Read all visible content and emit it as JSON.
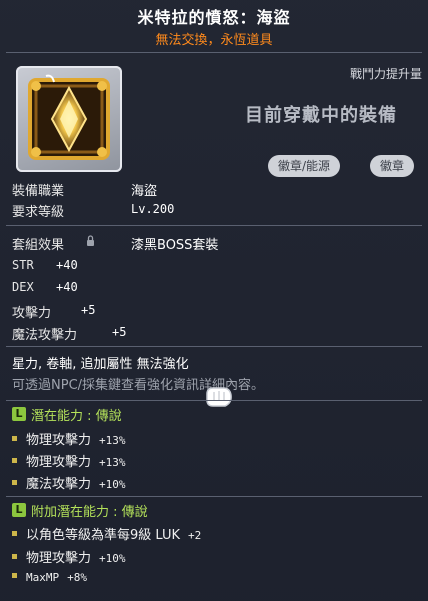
{
  "item": {
    "name": "米特拉的憤怒：海盜",
    "trade_note": "無法交換，永恆道具"
  },
  "header": {
    "power_up": "戰鬥力提升量",
    "current_equipped": "目前穿戴中的裝備"
  },
  "tags": [
    "徽章/能源",
    "徽章"
  ],
  "requirements": {
    "job_label": "裝備職業",
    "job_value": "海盜",
    "level_label": "要求等級",
    "level_value": "Lv.200"
  },
  "set": {
    "label": "套組效果",
    "value": "漆黑BOSS套裝"
  },
  "stats": [
    {
      "label": "STR",
      "value": "+40"
    },
    {
      "label": "DEX",
      "value": "+40"
    },
    {
      "label": "攻擊力",
      "value": "+5"
    },
    {
      "label": "魔法攻擊力",
      "value": "+5"
    }
  ],
  "enhance_note": "星力, 卷軸, 追加屬性 無法強化",
  "hint_text": "可透過NPC/採集鍵查看強化資訊詳細內容。",
  "potential": {
    "badge": "L",
    "title": "潛在能力 : 傳說",
    "lines": [
      {
        "label": "物理攻擊力",
        "value": "+13%"
      },
      {
        "label": "物理攻擊力",
        "value": "+13%"
      },
      {
        "label": "魔法攻擊力",
        "value": "+10%"
      }
    ]
  },
  "additional_potential": {
    "badge": "L",
    "title": "附加潛在能力 : 傳說",
    "lines": [
      {
        "label": "以角色等級為準每9級 LUK",
        "value": "+2"
      },
      {
        "label": "物理攻擊力",
        "value": "+10%"
      },
      {
        "label": "MaxMP",
        "value": "+8%"
      }
    ]
  },
  "colors": {
    "trade_note": "#ff8a1c",
    "potential_title": "#b4e25a",
    "badge": "#8cc63e",
    "bullet": "#cdb64a"
  },
  "icons": {
    "item": "mitra-rage-emblem-icon",
    "lock": "lock-icon",
    "cursor": "glove-cursor-icon"
  }
}
